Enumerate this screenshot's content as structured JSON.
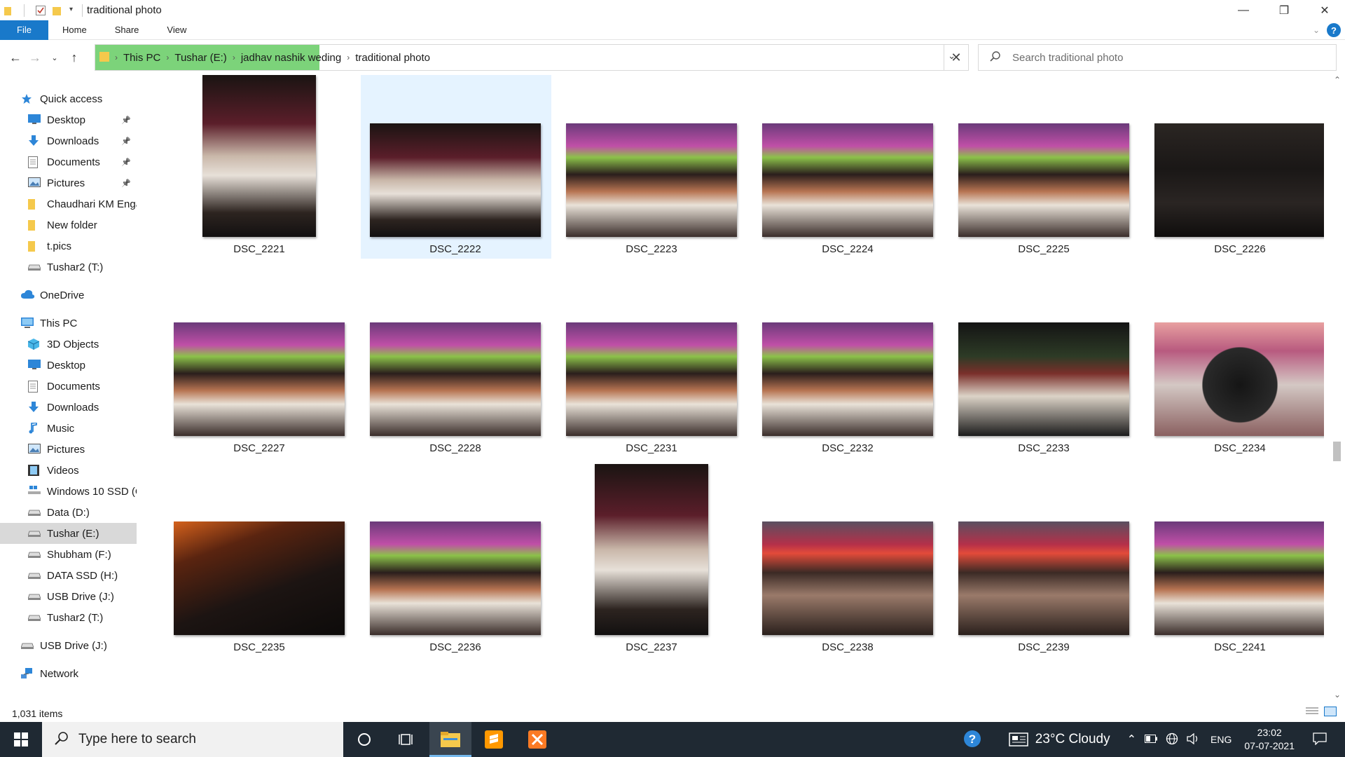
{
  "window": {
    "title": "traditional photo",
    "minimize": "—",
    "maximize": "❐",
    "close": "✕"
  },
  "ribbon": {
    "tabs": [
      "File",
      "Home",
      "Share",
      "View"
    ]
  },
  "address": {
    "crumbs": [
      "This PC",
      "Tushar (E:)",
      "jadhav nashik weding",
      "traditional photo"
    ],
    "search_placeholder": "Search traditional photo"
  },
  "sidebar": {
    "items": [
      {
        "label": "Quick access",
        "icon": "star-icon",
        "indent": 1,
        "pinned": false
      },
      {
        "label": "Desktop",
        "icon": "desktop-icon",
        "indent": 2,
        "pinned": true
      },
      {
        "label": "Downloads",
        "icon": "download-icon",
        "indent": 2,
        "pinned": true
      },
      {
        "label": "Documents",
        "icon": "documents-icon",
        "indent": 2,
        "pinned": true
      },
      {
        "label": "Pictures",
        "icon": "pictures-icon",
        "indent": 2,
        "pinned": true
      },
      {
        "label": "Chaudhari KM Enga",
        "icon": "folder-icon",
        "indent": 2,
        "pinned": false
      },
      {
        "label": "New folder",
        "icon": "folder-icon",
        "indent": 2,
        "pinned": false
      },
      {
        "label": "t.pics",
        "icon": "folder-icon",
        "indent": 2,
        "pinned": false
      },
      {
        "label": "Tushar2 (T:)",
        "icon": "drive-icon",
        "indent": 2,
        "pinned": false
      },
      {
        "label": "OneDrive",
        "icon": "cloud-icon",
        "indent": 1,
        "pinned": false
      },
      {
        "label": "This PC",
        "icon": "computer-icon",
        "indent": 1,
        "pinned": false
      },
      {
        "label": "3D Objects",
        "icon": "cube-icon",
        "indent": 2,
        "pinned": false
      },
      {
        "label": "Desktop",
        "icon": "desktop-icon",
        "indent": 2,
        "pinned": false
      },
      {
        "label": "Documents",
        "icon": "documents-icon",
        "indent": 2,
        "pinned": false
      },
      {
        "label": "Downloads",
        "icon": "download-icon",
        "indent": 2,
        "pinned": false
      },
      {
        "label": "Music",
        "icon": "music-icon",
        "indent": 2,
        "pinned": false
      },
      {
        "label": "Pictures",
        "icon": "pictures-icon",
        "indent": 2,
        "pinned": false
      },
      {
        "label": "Videos",
        "icon": "video-icon",
        "indent": 2,
        "pinned": false
      },
      {
        "label": "Windows 10 SSD (C",
        "icon": "windows-drive-icon",
        "indent": 2,
        "pinned": false
      },
      {
        "label": "Data (D:)",
        "icon": "drive-icon",
        "indent": 2,
        "pinned": false
      },
      {
        "label": "Tushar (E:)",
        "icon": "drive-icon",
        "indent": 2,
        "pinned": false,
        "selected": true
      },
      {
        "label": "Shubham (F:)",
        "icon": "drive-icon",
        "indent": 2,
        "pinned": false
      },
      {
        "label": "DATA SSD (H:)",
        "icon": "drive-icon",
        "indent": 2,
        "pinned": false
      },
      {
        "label": "USB Drive (J:)",
        "icon": "drive-icon",
        "indent": 2,
        "pinned": false
      },
      {
        "label": "Tushar2 (T:)",
        "icon": "drive-icon",
        "indent": 2,
        "pinned": false
      },
      {
        "label": "USB Drive (J:)",
        "icon": "drive-icon",
        "indent": 1,
        "pinned": false
      },
      {
        "label": "Network",
        "icon": "network-icon",
        "indent": 1,
        "pinned": false
      }
    ]
  },
  "files": [
    {
      "name": "DSC_2221",
      "orientation": "portrait",
      "scene": "horse"
    },
    {
      "name": "DSC_2222",
      "orientation": "landscape",
      "scene": "horse",
      "selected": true
    },
    {
      "name": "DSC_2223",
      "orientation": "landscape",
      "scene": "crowd"
    },
    {
      "name": "DSC_2224",
      "orientation": "landscape",
      "scene": "crowd"
    },
    {
      "name": "DSC_2225",
      "orientation": "landscape",
      "scene": "crowd"
    },
    {
      "name": "DSC_2226",
      "orientation": "landscape",
      "scene": "dark"
    },
    {
      "name": "DSC_2227",
      "orientation": "landscape",
      "scene": "crowd"
    },
    {
      "name": "DSC_2228",
      "orientation": "landscape",
      "scene": "crowd"
    },
    {
      "name": "DSC_2231",
      "orientation": "landscape",
      "scene": "crowd"
    },
    {
      "name": "DSC_2232",
      "orientation": "landscape",
      "scene": "crowd"
    },
    {
      "name": "DSC_2233",
      "orientation": "landscape",
      "scene": "night"
    },
    {
      "name": "DSC_2234",
      "orientation": "landscape",
      "scene": "confetti"
    },
    {
      "name": "DSC_2235",
      "orientation": "landscape",
      "scene": "dark-orange"
    },
    {
      "name": "DSC_2236",
      "orientation": "landscape",
      "scene": "crowd"
    },
    {
      "name": "DSC_2237",
      "orientation": "portrait",
      "scene": "horse"
    },
    {
      "name": "DSC_2238",
      "orientation": "landscape",
      "scene": "banner"
    },
    {
      "name": "DSC_2239",
      "orientation": "landscape",
      "scene": "banner"
    },
    {
      "name": "DSC_2241",
      "orientation": "landscape",
      "scene": "crowd"
    }
  ],
  "status": {
    "count": "1,031 items"
  },
  "taskbar": {
    "search_placeholder": "Type here to search",
    "weather": "23°C  Cloudy",
    "lang": "ENG",
    "time": "23:02",
    "date": "07-07-2021"
  },
  "colors": {
    "accent": "#1979ca",
    "selection": "#e5f3ff",
    "taskbar": "#1f2933",
    "progress": "#7cd37a"
  }
}
